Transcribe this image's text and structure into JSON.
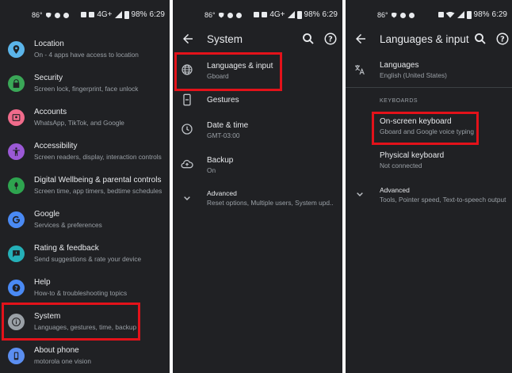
{
  "status_bars": [
    {
      "temp": "86°",
      "network": "4G+",
      "battery": "98%",
      "time": "6:29"
    },
    {
      "temp": "86°",
      "network": "4G+",
      "battery": "98%",
      "time": "6:29"
    },
    {
      "temp": "86°",
      "battery": "98%",
      "time": "6:29"
    }
  ],
  "settings": {
    "items": [
      {
        "title": "Location",
        "subtitle": "On - 4 apps have access to location",
        "icon": "location-icon",
        "color": "#5bb5ea"
      },
      {
        "title": "Security",
        "subtitle": "Screen lock, fingerprint, face unlock",
        "icon": "lock-icon",
        "color": "#3aa757"
      },
      {
        "title": "Accounts",
        "subtitle": "WhatsApp, TikTok, and Google",
        "icon": "accounts-icon",
        "color": "#f06b8b"
      },
      {
        "title": "Accessibility",
        "subtitle": "Screen readers, display, interaction controls",
        "icon": "accessibility-icon",
        "color": "#9b59d6"
      },
      {
        "title": "Digital Wellbeing & parental controls",
        "subtitle": "Screen time, app timers, bedtime schedules",
        "icon": "wellbeing-icon",
        "color": "#2ea44f"
      },
      {
        "title": "Google",
        "subtitle": "Services & preferences",
        "icon": "google-icon",
        "color": "#4a8af4"
      },
      {
        "title": "Rating & feedback",
        "subtitle": "Send suggestions & rate your device",
        "icon": "feedback-icon",
        "color": "#25b0b8"
      },
      {
        "title": "Help",
        "subtitle": "How-to & troubleshooting topics",
        "icon": "help-icon",
        "color": "#4a8af4"
      },
      {
        "title": "System",
        "subtitle": "Languages, gestures, time, backup",
        "icon": "info-icon",
        "color": "#9aa0a6"
      },
      {
        "title": "About phone",
        "subtitle": "motorola one vision",
        "icon": "phone-icon",
        "color": "#5b8ef0"
      }
    ]
  },
  "system": {
    "title": "System",
    "items": [
      {
        "title": "Languages & input",
        "subtitle": "Gboard",
        "icon": "globe-icon"
      },
      {
        "title": "Gestures",
        "subtitle": "",
        "icon": "gestures-icon"
      },
      {
        "title": "Date & time",
        "subtitle": "GMT-03:00",
        "icon": "clock-icon"
      },
      {
        "title": "Backup",
        "subtitle": "On",
        "icon": "backup-icon"
      },
      {
        "title": "Advanced",
        "subtitle": "Reset options, Multiple users, System upd..",
        "icon": "chevron-down-icon"
      }
    ]
  },
  "languages": {
    "title": "Languages & input",
    "languages_item": {
      "title": "Languages",
      "subtitle": "English (United States)"
    },
    "section_header": "KEYBOARDS",
    "onscreen": {
      "title": "On-screen keyboard",
      "subtitle": "Gboard and Google voice typing"
    },
    "physical": {
      "title": "Physical keyboard",
      "subtitle": "Not connected"
    },
    "advanced": {
      "title": "Advanced",
      "subtitle": "Tools, Pointer speed, Text-to-speech output"
    }
  },
  "colors": {
    "background": "#202124",
    "highlight": "#e3121a",
    "text": "#e8eaed",
    "subtext": "#9aa0a6"
  }
}
